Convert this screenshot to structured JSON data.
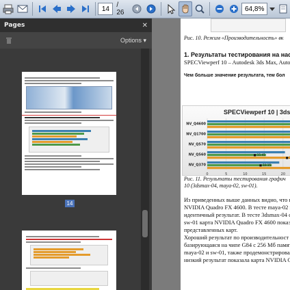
{
  "toolbar": {
    "page_current": "14",
    "page_total": "/ 26",
    "zoom": "64,8%"
  },
  "panel": {
    "title": "Pages",
    "close": "✕",
    "options_label": "Options ▾",
    "page_badge": "14"
  },
  "doc": {
    "caption_top": "Рис. 10. Режим «Производительность» вк",
    "section_title": "1. Результаты тестирования на настр",
    "section_sub": "SPECViewperf 10 – Autodesk 3ds Max, Auto",
    "note": "Чем больше значение результата, тем бол",
    "caption_fig11_a": "Рис. 11. Результаты тестирования графич",
    "caption_fig11_b": "10 (3dsmax-04, maya-02, sw-01).",
    "para": [
      "Из приведенных выше данных видно, что в",
      "NVIDIA Quadro FX 4600. В тесте maya-02 к",
      "идентичный результат. В тесте 3dsmax-04 с",
      "sw-01 карта NVIDIA Quadro FX 4600 показа",
      "представленных карт.",
      "Хороший результат по производительност",
      "базирующаяся на чипе G84 с 256 Мб памят",
      "maya-02 и sw-01, также продемонстрировал",
      "низкий результат показала карта NVIDIA Q"
    ]
  },
  "chart_data": {
    "type": "bar",
    "title": "SPECViewperf 10 | 3dsmax-04, m",
    "categories": [
      "NV_Q4600",
      "NV_Q1700",
      "NV_Q570",
      "NV_Q560",
      "NV_Q370"
    ],
    "series": [
      {
        "name": "",
        "color": "#3a7fb0",
        "values": [
          33.2,
          28.5,
          27.0,
          20.5,
          19.0
        ]
      },
      {
        "name": "",
        "color": "#4e9a4a",
        "values": [
          31.0,
          26.8,
          26.0,
          15.5,
          17.0
        ]
      },
      {
        "name": "",
        "color": "#e49b2c",
        "values": [
          25.0,
          24.0,
          25.92,
          24.0,
          30.55
        ]
      }
    ],
    "data_labels": [
      "",
      "",
      "25.92",
      "24.00",
      "30.55"
    ],
    "small_labels": [
      "",
      "",
      "",
      "11.41",
      "10.15"
    ],
    "xlim": [
      0,
      35
    ],
    "xticks": [
      "0",
      "5",
      "10",
      "15",
      "20",
      "25",
      "30"
    ]
  }
}
